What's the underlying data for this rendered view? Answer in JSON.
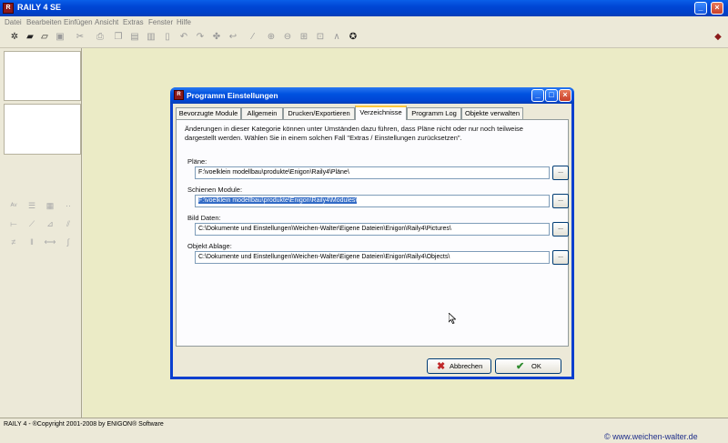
{
  "window": {
    "title": "RAILY 4 SE"
  },
  "menu": [
    "Datei",
    "Bearbeiten",
    "Einfügen",
    "Ansicht",
    "Extras",
    "Fenster",
    "Hilfe"
  ],
  "dialog": {
    "title": "Programm Einstellungen",
    "tabs": [
      "Bevorzugte Module",
      "Allgemein",
      "Drucken/Exportieren",
      "Verzeichnisse",
      "Programm Log",
      "Objekte verwalten"
    ],
    "active_tab": "Verzeichnisse",
    "intro_line1": "Änderungen in dieser Kategorie können unter Umständen dazu führen, dass Pläne nicht oder nur noch teilweise",
    "intro_line2": "dargestellt werden. Wählen Sie in einem solchen Fall \"Extras / Einstellungen zurücksetzen\".",
    "fields": [
      {
        "label": "Pläne:",
        "value": "F:\\voelklein modellbau\\produkte\\Enigon\\Raily4\\Pläne\\"
      },
      {
        "label": "Schienen Module:",
        "value": "F:\\voelklein modellbau\\produkte\\Enigon\\Raily4\\Modules\\"
      },
      {
        "label": "Bild Daten:",
        "value": "C:\\Dokumente und Einstellungen\\Weichen-Walter\\Eigene Dateien\\Enigon\\Raily4\\Pictures\\"
      },
      {
        "label": "Objekt Ablage:",
        "value": "C:\\Dokumente und Einstellungen\\Weichen-Walter\\Eigene Dateien\\Enigon\\Raily4\\Objects\\"
      }
    ],
    "browse_label": "...",
    "cancel_label": "Abbrechen",
    "ok_label": "OK"
  },
  "status": {
    "text": "RAILY 4 - ®Copyright 2001-2008 by ENIGON® Software"
  },
  "watermark": "© www.weichen-walter.de",
  "colors": {
    "workspace": "#ebebc6",
    "titlebar": "#0046d5",
    "selection": "#316ac5"
  }
}
